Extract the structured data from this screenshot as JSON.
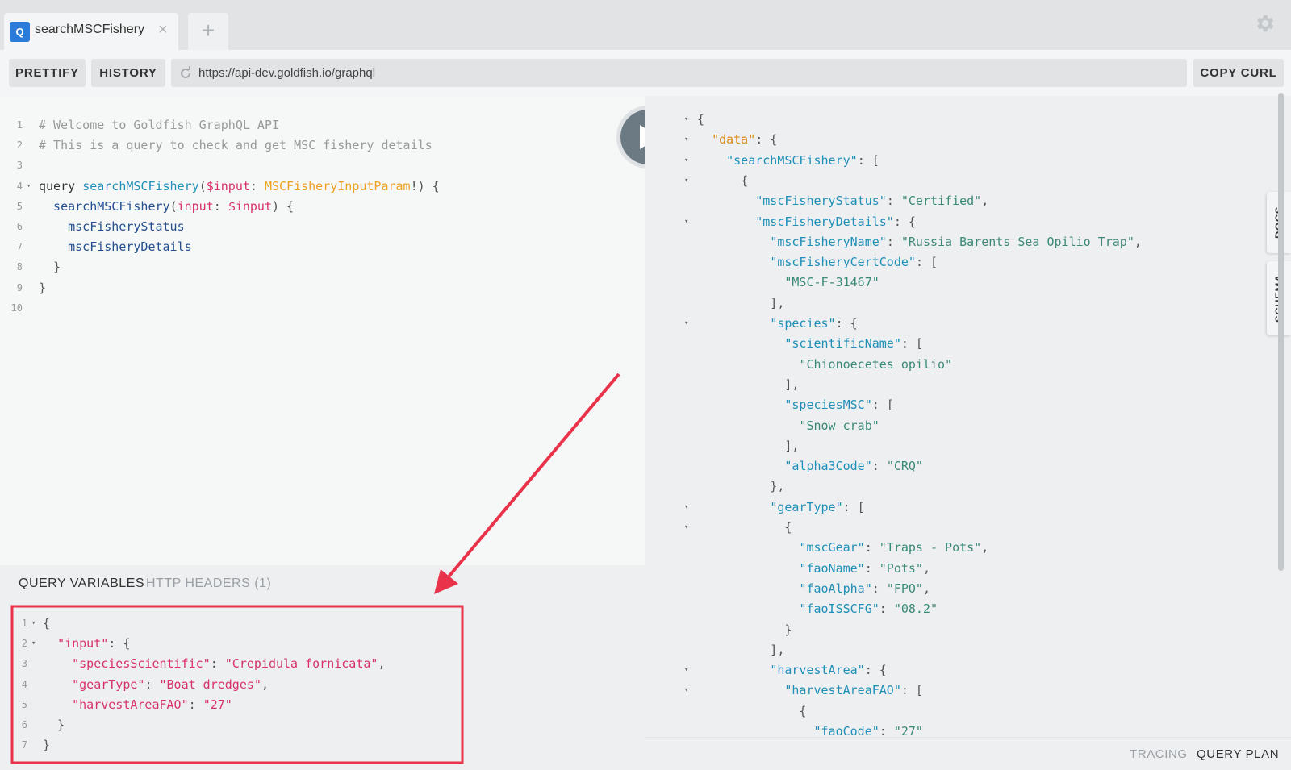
{
  "tabs": [
    {
      "badge": "Q",
      "title": "searchMSCFishery",
      "close": "×"
    }
  ],
  "new_tab": "+",
  "toolbar": {
    "prettify": "PRETTIFY",
    "history": "HISTORY",
    "url": "https://api-dev.goldfish.io/graphql",
    "copy_curl": "COPY CURL"
  },
  "query_editor": {
    "lines": [
      {
        "n": "1",
        "tokens": [
          {
            "t": "# Welcome to Goldfish GraphQL API",
            "c": "c-comment"
          }
        ]
      },
      {
        "n": "2",
        "tokens": [
          {
            "t": "# This is a query to check and get MSC fishery details",
            "c": "c-comment"
          }
        ]
      },
      {
        "n": "3",
        "tokens": []
      },
      {
        "n": "4",
        "fold": true,
        "tokens": [
          {
            "t": "query ",
            "c": "c-kw"
          },
          {
            "t": "searchMSCFishery",
            "c": "c-def"
          },
          {
            "t": "(",
            "c": "c-punc"
          },
          {
            "t": "$input",
            "c": "c-var"
          },
          {
            "t": ": ",
            "c": "c-punc"
          },
          {
            "t": "MSCFisheryInputParam",
            "c": "c-type"
          },
          {
            "t": "!) {",
            "c": "c-punc"
          }
        ]
      },
      {
        "n": "5",
        "tokens": [
          {
            "t": "  searchMSCFishery",
            "c": "c-field"
          },
          {
            "t": "(",
            "c": "c-punc"
          },
          {
            "t": "input",
            "c": "c-key"
          },
          {
            "t": ": ",
            "c": "c-punc"
          },
          {
            "t": "$input",
            "c": "c-var"
          },
          {
            "t": ") {",
            "c": "c-punc"
          }
        ]
      },
      {
        "n": "6",
        "tokens": [
          {
            "t": "    mscFisheryStatus",
            "c": "c-field"
          }
        ]
      },
      {
        "n": "7",
        "tokens": [
          {
            "t": "    mscFisheryDetails",
            "c": "c-field"
          }
        ]
      },
      {
        "n": "8",
        "tokens": [
          {
            "t": "  }",
            "c": "c-punc"
          }
        ]
      },
      {
        "n": "9",
        "tokens": [
          {
            "t": "}",
            "c": "c-punc"
          }
        ]
      },
      {
        "n": "10",
        "tokens": []
      }
    ]
  },
  "variables_panel": {
    "tab_active": "QUERY VARIABLES",
    "tab_other": "HTTP HEADERS (1)",
    "lines": [
      {
        "n": "1",
        "fold": true,
        "tokens": [
          {
            "t": "{",
            "c": "c-punc"
          }
        ]
      },
      {
        "n": "2",
        "fold": true,
        "tokens": [
          {
            "t": "  ",
            "c": "c-punc"
          },
          {
            "t": "\"input\"",
            "c": "c-key"
          },
          {
            "t": ": {",
            "c": "c-punc"
          }
        ]
      },
      {
        "n": "3",
        "tokens": [
          {
            "t": "    ",
            "c": "c-punc"
          },
          {
            "t": "\"speciesScientific\"",
            "c": "c-key"
          },
          {
            "t": ": ",
            "c": "c-punc"
          },
          {
            "t": "\"Crepidula fornicata\"",
            "c": "c-str"
          },
          {
            "t": ",",
            "c": "c-punc"
          }
        ]
      },
      {
        "n": "4",
        "tokens": [
          {
            "t": "    ",
            "c": "c-punc"
          },
          {
            "t": "\"gearType\"",
            "c": "c-key"
          },
          {
            "t": ": ",
            "c": "c-punc"
          },
          {
            "t": "\"Boat dredges\"",
            "c": "c-str"
          },
          {
            "t": ",",
            "c": "c-punc"
          }
        ]
      },
      {
        "n": "5",
        "tokens": [
          {
            "t": "    ",
            "c": "c-punc"
          },
          {
            "t": "\"harvestAreaFAO\"",
            "c": "c-key"
          },
          {
            "t": ": ",
            "c": "c-punc"
          },
          {
            "t": "\"27\"",
            "c": "c-str"
          }
        ]
      },
      {
        "n": "6",
        "tokens": [
          {
            "t": "  }",
            "c": "c-punc"
          }
        ]
      },
      {
        "n": "7",
        "tokens": [
          {
            "t": "}",
            "c": "c-punc"
          }
        ]
      }
    ]
  },
  "result_panel": {
    "lines": [
      {
        "fold": true,
        "tokens": [
          {
            "t": "{",
            "c": "c-punc"
          }
        ]
      },
      {
        "fold": true,
        "tokens": [
          {
            "t": "  ",
            "c": "c-punc"
          },
          {
            "t": "\"data\"",
            "c": "r-data"
          },
          {
            "t": ": {",
            "c": "c-punc"
          }
        ]
      },
      {
        "fold": true,
        "tokens": [
          {
            "t": "    ",
            "c": "c-punc"
          },
          {
            "t": "\"searchMSCFishery\"",
            "c": "r-key"
          },
          {
            "t": ": [",
            "c": "c-punc"
          }
        ]
      },
      {
        "fold": true,
        "tokens": [
          {
            "t": "      {",
            "c": "c-punc"
          }
        ]
      },
      {
        "tokens": [
          {
            "t": "        ",
            "c": "c-punc"
          },
          {
            "t": "\"mscFisheryStatus\"",
            "c": "r-key"
          },
          {
            "t": ": ",
            "c": "c-punc"
          },
          {
            "t": "\"Certified\"",
            "c": "r-str"
          },
          {
            "t": ",",
            "c": "c-punc"
          }
        ]
      },
      {
        "fold": true,
        "tokens": [
          {
            "t": "        ",
            "c": "c-punc"
          },
          {
            "t": "\"mscFisheryDetails\"",
            "c": "r-key"
          },
          {
            "t": ": {",
            "c": "c-punc"
          }
        ]
      },
      {
        "tokens": [
          {
            "t": "          ",
            "c": "c-punc"
          },
          {
            "t": "\"mscFisheryName\"",
            "c": "r-key"
          },
          {
            "t": ": ",
            "c": "c-punc"
          },
          {
            "t": "\"Russia Barents Sea Opilio Trap\"",
            "c": "r-str"
          },
          {
            "t": ",",
            "c": "c-punc"
          }
        ]
      },
      {
        "tokens": [
          {
            "t": "          ",
            "c": "c-punc"
          },
          {
            "t": "\"mscFisheryCertCode\"",
            "c": "r-key"
          },
          {
            "t": ": [",
            "c": "c-punc"
          }
        ]
      },
      {
        "tokens": [
          {
            "t": "            ",
            "c": "c-punc"
          },
          {
            "t": "\"MSC-F-31467\"",
            "c": "r-str"
          }
        ]
      },
      {
        "tokens": [
          {
            "t": "          ],",
            "c": "c-punc"
          }
        ]
      },
      {
        "fold": true,
        "tokens": [
          {
            "t": "          ",
            "c": "c-punc"
          },
          {
            "t": "\"species\"",
            "c": "r-key"
          },
          {
            "t": ": {",
            "c": "c-punc"
          }
        ]
      },
      {
        "tokens": [
          {
            "t": "            ",
            "c": "c-punc"
          },
          {
            "t": "\"scientificName\"",
            "c": "r-key"
          },
          {
            "t": ": [",
            "c": "c-punc"
          }
        ]
      },
      {
        "tokens": [
          {
            "t": "              ",
            "c": "c-punc"
          },
          {
            "t": "\"Chionoecetes opilio\"",
            "c": "r-str"
          }
        ]
      },
      {
        "tokens": [
          {
            "t": "            ],",
            "c": "c-punc"
          }
        ]
      },
      {
        "tokens": [
          {
            "t": "            ",
            "c": "c-punc"
          },
          {
            "t": "\"speciesMSC\"",
            "c": "r-key"
          },
          {
            "t": ": [",
            "c": "c-punc"
          }
        ]
      },
      {
        "tokens": [
          {
            "t": "              ",
            "c": "c-punc"
          },
          {
            "t": "\"Snow crab\"",
            "c": "r-str"
          }
        ]
      },
      {
        "tokens": [
          {
            "t": "            ],",
            "c": "c-punc"
          }
        ]
      },
      {
        "tokens": [
          {
            "t": "            ",
            "c": "c-punc"
          },
          {
            "t": "\"alpha3Code\"",
            "c": "r-key"
          },
          {
            "t": ": ",
            "c": "c-punc"
          },
          {
            "t": "\"CRQ\"",
            "c": "r-str"
          }
        ]
      },
      {
        "tokens": [
          {
            "t": "          },",
            "c": "c-punc"
          }
        ]
      },
      {
        "fold": true,
        "tokens": [
          {
            "t": "          ",
            "c": "c-punc"
          },
          {
            "t": "\"gearType\"",
            "c": "r-key"
          },
          {
            "t": ": [",
            "c": "c-punc"
          }
        ]
      },
      {
        "fold": true,
        "tokens": [
          {
            "t": "            {",
            "c": "c-punc"
          }
        ]
      },
      {
        "tokens": [
          {
            "t": "              ",
            "c": "c-punc"
          },
          {
            "t": "\"mscGear\"",
            "c": "r-key"
          },
          {
            "t": ": ",
            "c": "c-punc"
          },
          {
            "t": "\"Traps - Pots\"",
            "c": "r-str"
          },
          {
            "t": ",",
            "c": "c-punc"
          }
        ]
      },
      {
        "tokens": [
          {
            "t": "              ",
            "c": "c-punc"
          },
          {
            "t": "\"faoName\"",
            "c": "r-key"
          },
          {
            "t": ": ",
            "c": "c-punc"
          },
          {
            "t": "\"Pots\"",
            "c": "r-str"
          },
          {
            "t": ",",
            "c": "c-punc"
          }
        ]
      },
      {
        "tokens": [
          {
            "t": "              ",
            "c": "c-punc"
          },
          {
            "t": "\"faoAlpha\"",
            "c": "r-key"
          },
          {
            "t": ": ",
            "c": "c-punc"
          },
          {
            "t": "\"FPO\"",
            "c": "r-str"
          },
          {
            "t": ",",
            "c": "c-punc"
          }
        ]
      },
      {
        "tokens": [
          {
            "t": "              ",
            "c": "c-punc"
          },
          {
            "t": "\"faoISSCFG\"",
            "c": "r-key"
          },
          {
            "t": ": ",
            "c": "c-punc"
          },
          {
            "t": "\"08.2\"",
            "c": "r-str"
          }
        ]
      },
      {
        "tokens": [
          {
            "t": "            }",
            "c": "c-punc"
          }
        ]
      },
      {
        "tokens": [
          {
            "t": "          ],",
            "c": "c-punc"
          }
        ]
      },
      {
        "fold": true,
        "tokens": [
          {
            "t": "          ",
            "c": "c-punc"
          },
          {
            "t": "\"harvestArea\"",
            "c": "r-key"
          },
          {
            "t": ": {",
            "c": "c-punc"
          }
        ]
      },
      {
        "fold": true,
        "tokens": [
          {
            "t": "            ",
            "c": "c-punc"
          },
          {
            "t": "\"harvestAreaFAO\"",
            "c": "r-key"
          },
          {
            "t": ": [",
            "c": "c-punc"
          }
        ]
      },
      {
        "tokens": [
          {
            "t": "              {",
            "c": "c-punc"
          }
        ]
      },
      {
        "tokens": [
          {
            "t": "                ",
            "c": "c-punc"
          },
          {
            "t": "\"faoCode\"",
            "c": "r-key"
          },
          {
            "t": ": ",
            "c": "c-punc"
          },
          {
            "t": "\"27\"",
            "c": "r-str"
          }
        ]
      }
    ]
  },
  "side_tabs": {
    "docs": "DOCS",
    "schema": "SCHEMA"
  },
  "footer": {
    "tracing": "TRACING",
    "query_plan": "QUERY PLAN"
  },
  "colors": {
    "accent": "#2b7bdb",
    "annotation": "#e8334a",
    "run_button": "#6c7a84"
  },
  "icons": {
    "settings": "gear-icon",
    "run": "play-icon",
    "reload": "reload-icon"
  }
}
